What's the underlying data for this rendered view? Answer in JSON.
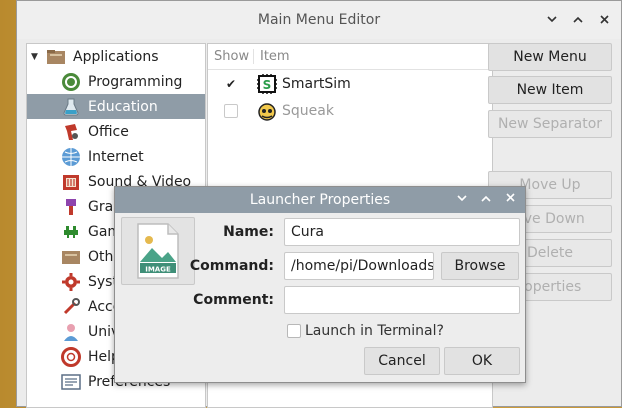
{
  "window": {
    "title": "Main Menu Editor",
    "controls": [
      "v",
      "^",
      "x"
    ]
  },
  "tree": {
    "root_label": "Applications",
    "items": [
      {
        "label": "Programming",
        "icon": "programming-icon"
      },
      {
        "label": "Education",
        "icon": "education-icon",
        "selected": true
      },
      {
        "label": "Office",
        "icon": "office-icon"
      },
      {
        "label": "Internet",
        "icon": "internet-icon"
      },
      {
        "label": "Sound & Video",
        "icon": "sound-video-icon"
      },
      {
        "label": "Grap",
        "icon": "graphics-icon"
      },
      {
        "label": "Gam",
        "icon": "games-icon"
      },
      {
        "label": "Othe",
        "icon": "other-icon"
      },
      {
        "label": "Syst",
        "icon": "system-icon"
      },
      {
        "label": "Acce",
        "icon": "accessories-icon"
      },
      {
        "label": "Univ",
        "icon": "universal-access-icon"
      },
      {
        "label": "Help",
        "icon": "help-icon"
      },
      {
        "label": "Preferences",
        "icon": "preferences-icon"
      }
    ]
  },
  "items_list": {
    "col_show": "Show",
    "col_item": "Item",
    "rows": [
      {
        "label": "SmartSim",
        "checked": true,
        "icon": "smartsim-icon"
      },
      {
        "label": "Squeak",
        "checked": false,
        "icon": "squeak-icon"
      }
    ]
  },
  "side_buttons": {
    "new_menu": "New Menu",
    "new_item": "New Item",
    "new_separator": "New Separator",
    "move_up": "Move Up",
    "move_down": "ove Down",
    "delete": "Delete",
    "properties": "roperties"
  },
  "dialog": {
    "title": "Launcher Properties",
    "controls": [
      "v",
      "^",
      "x"
    ],
    "icon_label": "IMAGE",
    "name_label": "Name:",
    "name_value": "Cura",
    "command_label": "Command:",
    "command_value": "/home/pi/Downloads",
    "browse_label": "Browse",
    "comment_label": "Comment:",
    "comment_value": "",
    "terminal_label": "Launch in Terminal?",
    "cancel_label": "Cancel",
    "ok_label": "OK"
  }
}
